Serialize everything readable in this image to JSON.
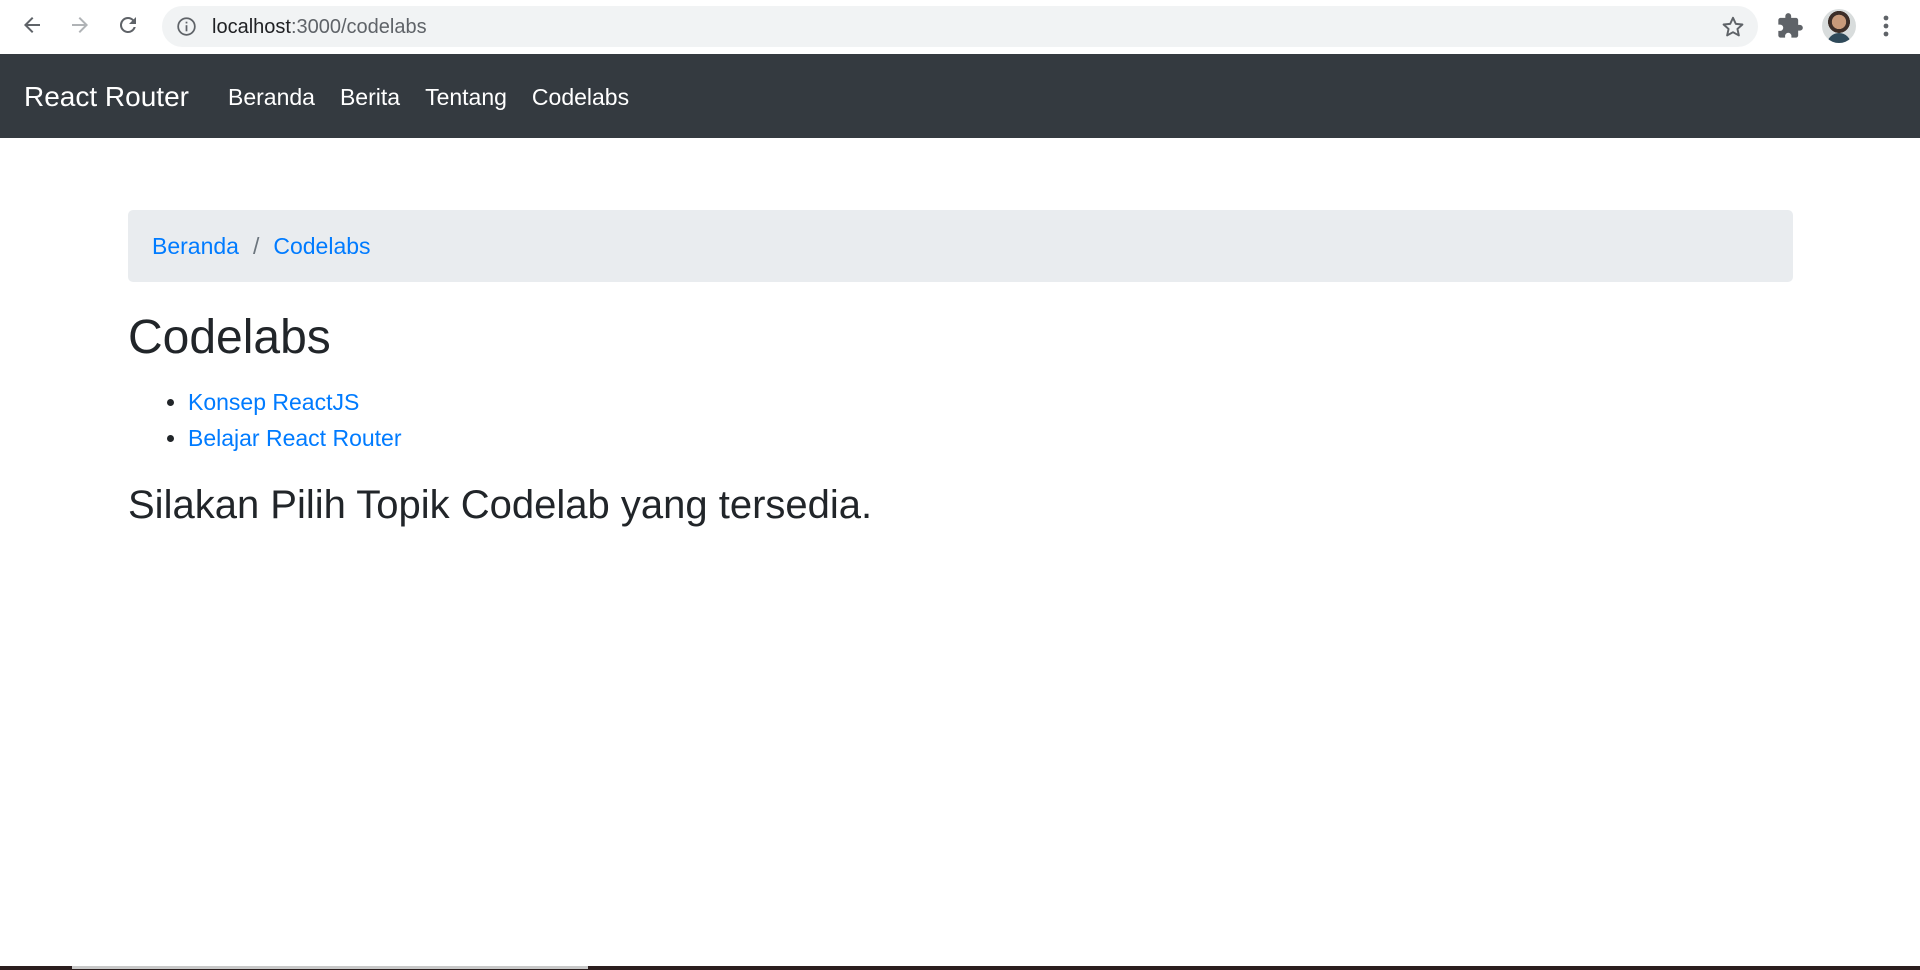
{
  "browser": {
    "url_host": "localhost",
    "url_path": ":3000/codelabs"
  },
  "navbar": {
    "brand": "React Router",
    "links": [
      {
        "label": "Beranda"
      },
      {
        "label": "Berita"
      },
      {
        "label": "Tentang"
      },
      {
        "label": "Codelabs"
      }
    ]
  },
  "breadcrumb": {
    "items": [
      {
        "label": "Beranda"
      },
      {
        "label": "Codelabs"
      }
    ],
    "separator": "/"
  },
  "page": {
    "title": "Codelabs",
    "topics": [
      {
        "label": "Konsep ReactJS"
      },
      {
        "label": "Belajar React Router"
      }
    ],
    "subtitle": "Silakan Pilih Topik Codelab yang tersedia."
  },
  "colors": {
    "navbar_bg": "#343a40",
    "link": "#007bff",
    "breadcrumb_bg": "#e9ecef",
    "text": "#212529"
  },
  "icons": {
    "back": "arrow-left-icon",
    "forward": "arrow-right-icon",
    "reload": "reload-icon",
    "info": "info-icon",
    "bookmark": "star-icon",
    "extensions": "puzzle-icon",
    "menu": "kebab-menu-icon"
  }
}
